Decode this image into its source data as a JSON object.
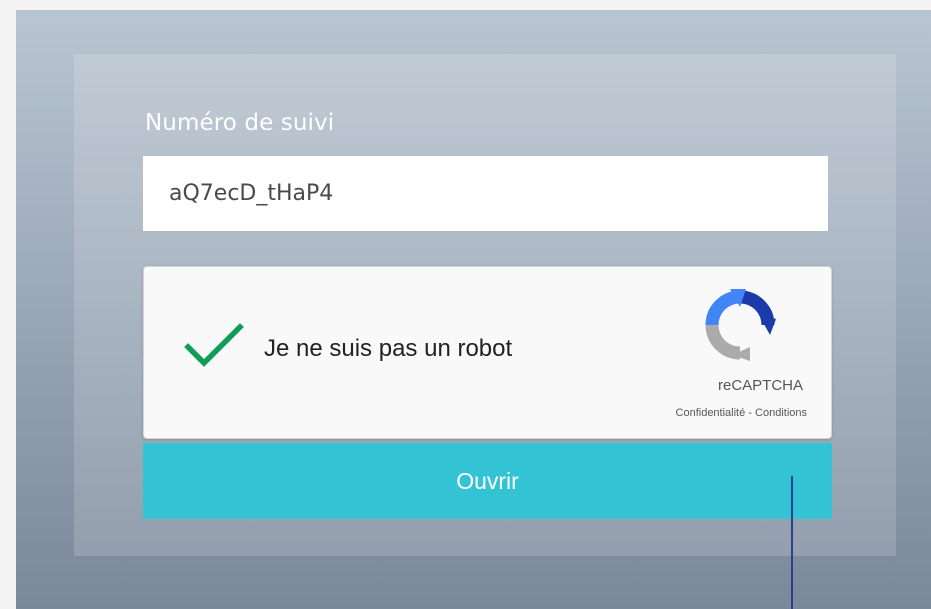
{
  "form": {
    "tracking_label": "Numéro de suivi",
    "tracking_value": "aQ7ecD_tHaP4",
    "submit_label": "Ouvrir"
  },
  "recaptcha": {
    "checked": true,
    "checkbox_label": "Je ne suis pas un robot",
    "brand": "reCAPTCHA",
    "privacy_link": "Confidentialité",
    "separator": " - ",
    "terms_link": "Conditions",
    "logo_icon": "recaptcha-logo-icon",
    "check_icon": "checkmark-icon"
  },
  "colors": {
    "accent": "#34c3d4",
    "checkmark": "#0f9d58",
    "pointer_line": "#2b3f8f"
  }
}
